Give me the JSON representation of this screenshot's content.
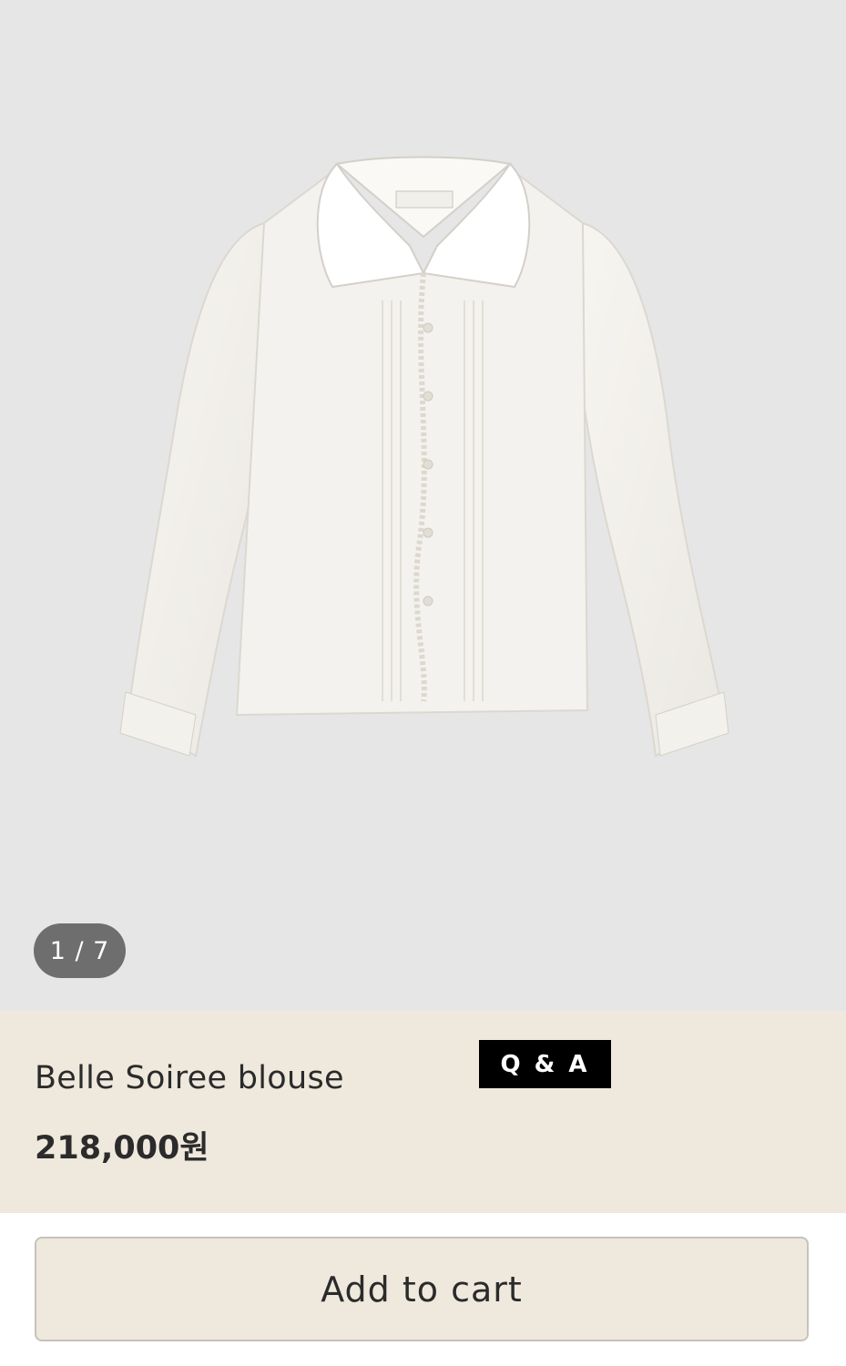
{
  "gallery": {
    "image_alt": "Belle Soiree blouse product photo",
    "counter": "1 / 7"
  },
  "product": {
    "name": "Belle Soiree blouse",
    "price": "218,000원"
  },
  "actions": {
    "qa_label": "Q & A",
    "add_to_cart_label": "Add to cart"
  }
}
